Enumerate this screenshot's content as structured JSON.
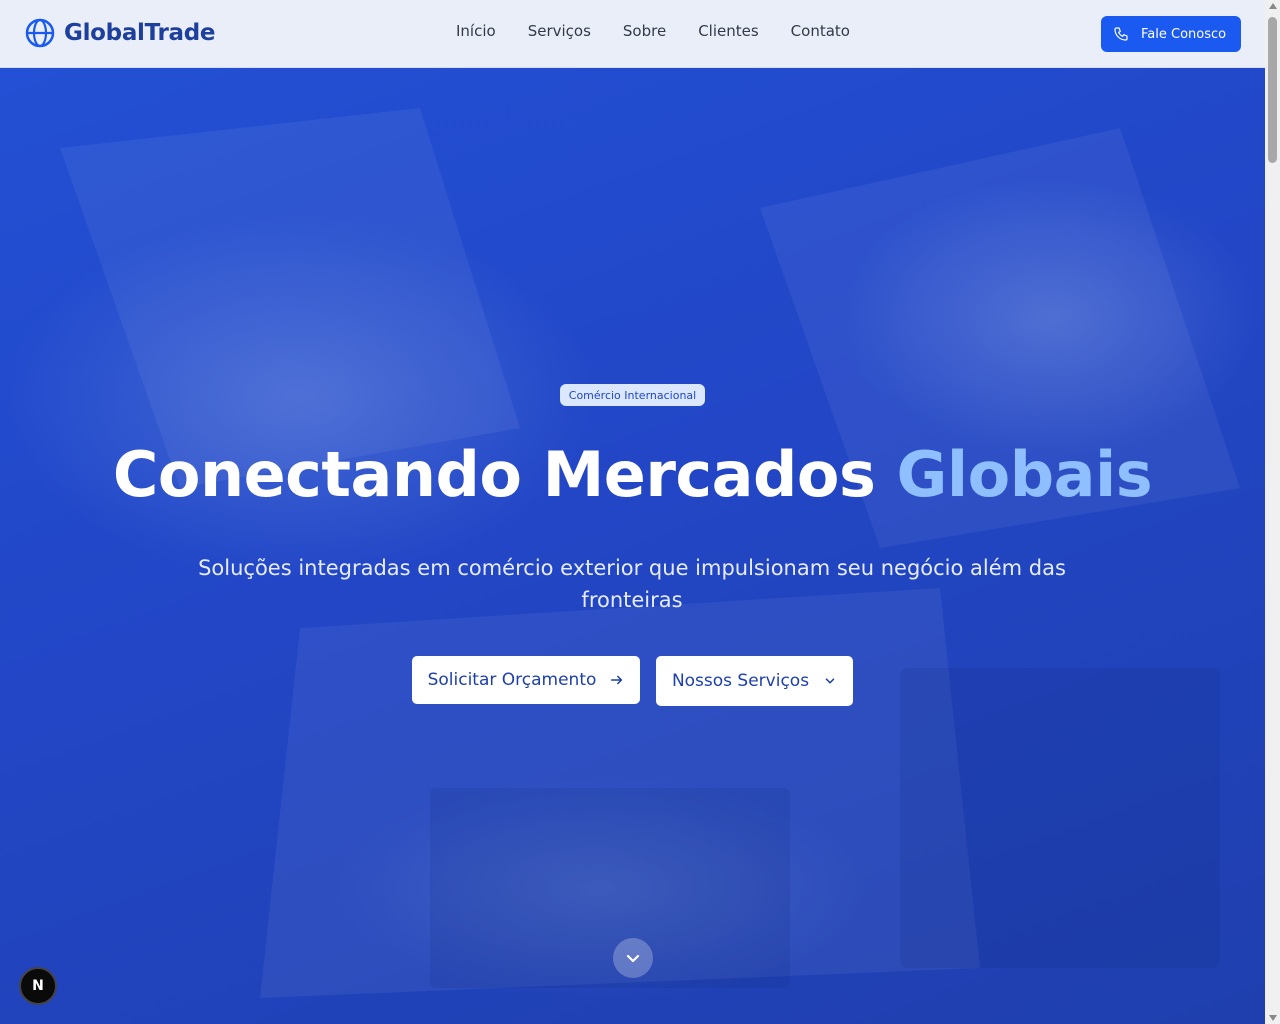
{
  "brand": {
    "name": "GlobalTrade",
    "icon": "globe-icon"
  },
  "nav": {
    "items": [
      "Início",
      "Serviços",
      "Sobre",
      "Clientes",
      "Contato"
    ]
  },
  "header_cta": {
    "label": "Fale Conosco",
    "icon": "phone-icon"
  },
  "hero": {
    "badge": "Comércio Internacional",
    "headline_main": "Conectando Mercados",
    "headline_highlight": "Globais",
    "subtitle": "Soluções integradas em comércio exterior que impulsionam seu negócio além das fronteiras",
    "primary_button": {
      "label": "Solicitar Orçamento",
      "icon": "arrow-right-icon"
    },
    "secondary_button": {
      "label": "Nossos Serviços",
      "icon": "chevron-down-icon"
    },
    "scroll_icon": "chevron-down-icon"
  },
  "dev_badge": {
    "label": "N"
  },
  "colors": {
    "brand": "#1d3f9e",
    "accent": "#1a5af0",
    "hero_bg": "#2246c6",
    "highlight": "#8fbfff"
  }
}
